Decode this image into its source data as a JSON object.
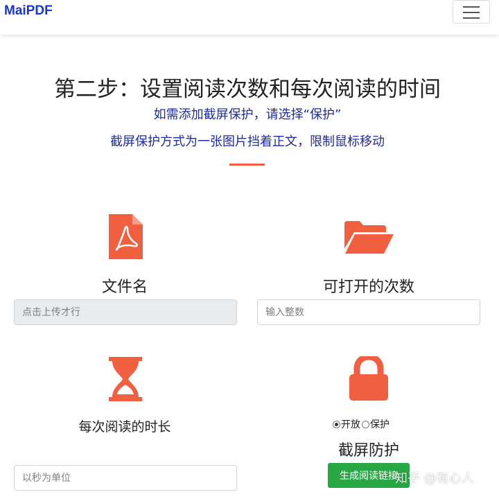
{
  "navbar": {
    "brand": "MaiPDF",
    "brand_color": "#1a35c8",
    "toggle_icon": "hamburger-menu-icon"
  },
  "header": {
    "title": "第二步：设置阅读次数和每次阅读的时间",
    "subtitle_1": "如需添加截屏保护，请选择“保护”",
    "subtitle_2": "截屏保护方式为一张图片挡着正文，限制鼠标移动",
    "accent_color": "#f05f40",
    "subtitle_color": "#1d2b9c"
  },
  "file_section": {
    "icon": "pdf-file-icon",
    "label": "文件名",
    "placeholder": "点击上传才行"
  },
  "open_count_section": {
    "icon": "folder-open-icon",
    "label": "可打开的次数",
    "placeholder": "输入整数"
  },
  "duration_section": {
    "icon": "hourglass-icon",
    "label": "每次阅读的时长",
    "placeholder": "以秒为单位"
  },
  "protection_section": {
    "icon": "lock-icon",
    "options": [
      {
        "label": "开放",
        "checked": true
      },
      {
        "label": "保护",
        "checked": false
      }
    ],
    "label": "截屏防护"
  },
  "submit": {
    "label": "生成阅读链接",
    "color": "#28a745"
  },
  "watermark": {
    "text": "知乎 @有心人"
  }
}
